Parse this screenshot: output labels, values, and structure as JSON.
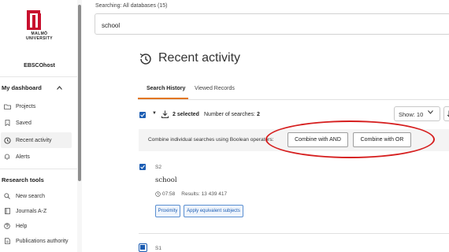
{
  "sidebar": {
    "university": [
      "MALMÖ",
      "UNIVERSITY"
    ],
    "ebsco": "EBSCOhost",
    "dashboard_heading": "My dashboard",
    "dashboard_items": [
      {
        "label": "Projects",
        "icon": "folder-icon"
      },
      {
        "label": "Saved",
        "icon": "bookmark-icon"
      },
      {
        "label": "Recent activity",
        "icon": "history-icon",
        "active": true
      },
      {
        "label": "Alerts",
        "icon": "bell-icon"
      }
    ],
    "research_heading": "Research tools",
    "research_items": [
      {
        "label": "New search",
        "icon": "search-icon"
      },
      {
        "label": "Journals A-Z",
        "icon": "journal-icon"
      },
      {
        "label": "Help",
        "icon": "help-icon"
      },
      {
        "label": "Publications authority",
        "icon": "document-icon"
      }
    ]
  },
  "top": {
    "searching_label": "Searching:",
    "databases": "All databases (15)",
    "query": "school"
  },
  "main": {
    "title": "Recent activity",
    "tabs": [
      "Search History",
      "Viewed Records"
    ],
    "selected_count": "2 selected",
    "num_searches_label": "Number of searches:",
    "num_searches": "2",
    "show": "Show: 10",
    "bool_label": "Combine individual searches using Boolean operators:",
    "combine_and": "Combine with AND",
    "combine_or": "Combine with OR",
    "searches": [
      {
        "id": "S2",
        "query": "school",
        "time": "07:58",
        "results": "Results: 13 439 417",
        "chips": [
          "Proximity",
          "Apply equivalent subjects"
        ]
      },
      {
        "id": "S1"
      }
    ]
  },
  "colors": {
    "accent": "#1c5db3",
    "tab_underline": "#e2761b",
    "annotation": "#d61f1f",
    "logo": "#c8102e"
  }
}
